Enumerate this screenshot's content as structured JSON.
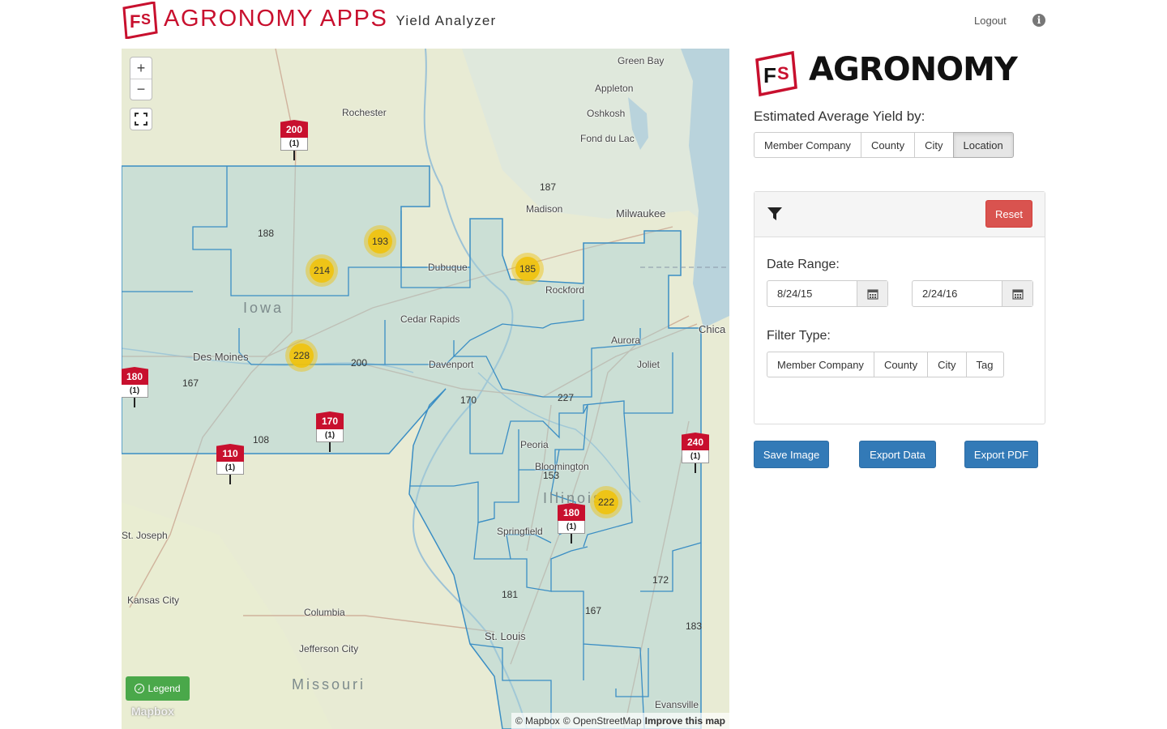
{
  "header": {
    "brand_title": "AGRONOMY APPS",
    "brand_subtitle": "Yield Analyzer",
    "logout_label": "Logout",
    "info_icon": "info-icon"
  },
  "map": {
    "zoom_in": "+",
    "zoom_out": "−",
    "state_labels": [
      "Iowa",
      "Illinois",
      "Missouri"
    ],
    "places": [
      "Green Bay",
      "Appleton",
      "Oshkosh",
      "Rochester",
      "Fond du Lac",
      "Madison",
      "Milwaukee",
      "Dubuque",
      "Rockford",
      "Cedar Rapids",
      "Des Moines",
      "Davenport",
      "Aurora",
      "Joliet",
      "Chica",
      "Peoria",
      "Bloomington",
      "Springfield",
      "St. Joseph",
      "Kansas City",
      "Columbia",
      "Jefferson City",
      "St. Louis",
      "Evansville"
    ],
    "clusters": [
      {
        "value": "187",
        "color": "green"
      },
      {
        "value": "188",
        "color": "green"
      },
      {
        "value": "193",
        "color": "yellow"
      },
      {
        "value": "214",
        "color": "yellow"
      },
      {
        "value": "185",
        "color": "yellow"
      },
      {
        "value": "228",
        "color": "yellow"
      },
      {
        "value": "200",
        "color": "green"
      },
      {
        "value": "167",
        "color": "green"
      },
      {
        "value": "170",
        "color": "green"
      },
      {
        "value": "227",
        "color": "green"
      },
      {
        "value": "108",
        "color": "green"
      },
      {
        "value": "153",
        "color": "green"
      },
      {
        "value": "222",
        "color": "yellow"
      },
      {
        "value": "181",
        "color": "green"
      },
      {
        "value": "167",
        "color": "green"
      },
      {
        "value": "172",
        "color": "green"
      },
      {
        "value": "183",
        "color": "green"
      }
    ],
    "flags": [
      {
        "value": "200",
        "count": "(1)"
      },
      {
        "value": "180",
        "count": "(1)"
      },
      {
        "value": "170",
        "count": "(1)"
      },
      {
        "value": "110",
        "count": "(1)"
      },
      {
        "value": "240",
        "count": "(1)"
      },
      {
        "value": "180",
        "count": "(1)"
      }
    ],
    "legend_label": "Legend",
    "mapbox_logo": "Mapbox",
    "attribution": {
      "mapbox": "© Mapbox",
      "osm": "© OpenStreetMap",
      "improve": "Improve this map"
    }
  },
  "panel": {
    "logo_word": "AGRONOMY",
    "yield_by_label": "Estimated Average Yield by:",
    "yield_by_options": [
      "Member Company",
      "County",
      "City",
      "Location"
    ],
    "yield_by_selected": "Location",
    "reset_label": "Reset",
    "date_range_label": "Date Range:",
    "date_start": "8/24/15",
    "date_end": "2/24/16",
    "filter_type_label": "Filter Type:",
    "filter_type_options": [
      "Member Company",
      "County",
      "City",
      "Tag"
    ],
    "save_image_label": "Save Image",
    "export_data_label": "Export Data",
    "export_pdf_label": "Export PDF"
  },
  "colors": {
    "brand_red": "#c8102e",
    "primary_blue": "#337ab7",
    "reset_red": "#d9534f",
    "legend_green": "#4aa84a",
    "cluster_green": "#6ecc39",
    "cluster_yellow": "#f0c20c"
  }
}
